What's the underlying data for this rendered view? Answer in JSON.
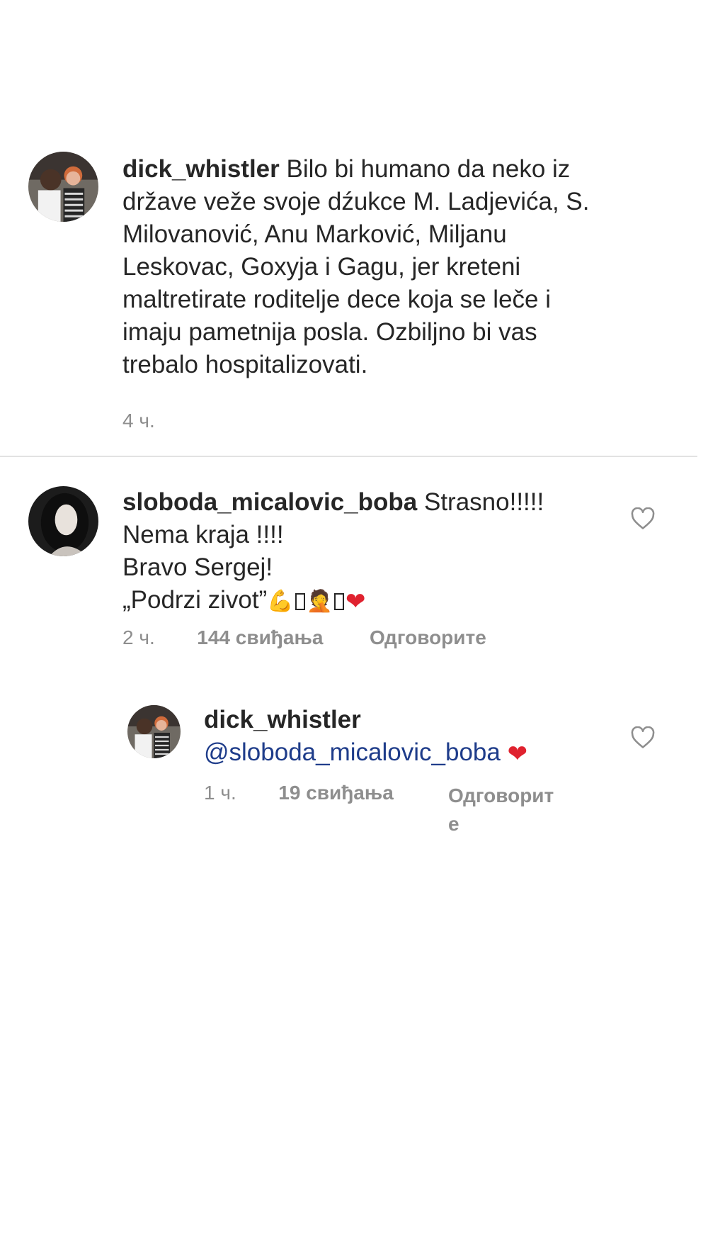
{
  "comments": [
    {
      "username": "dick_whistler",
      "text": "Bilo bi humano da neko iz\ndržave veže svoje dźukce M. Ladjevića, S.\nMilovanović, Anu Marković, Miljanu\nLeskovac, Goxyja i Gagu, jer kreteni\nmaltretirate roditelje dece koja se leče i\nimaju pametnija posla. Ozbiljno bi vas\ntrebalo hospitalizovati.",
      "time": "4 ч."
    },
    {
      "username": "sloboda_micalovic_boba",
      "text_first": "Strasno!!!!!",
      "text_rest": "Nema kraja !!!!\nBravo Sergej!\n„Podrzi zivot”",
      "time": "2 ч.",
      "likes": "144 свиђања",
      "reply_label": "Одговорите"
    },
    {
      "username": "dick_whistler",
      "mention": "@sloboda_micalovic_boba",
      "time": "1 ч.",
      "likes": "19 свиђања",
      "reply_label_line1": "Одговорит",
      "reply_label_line2": "е"
    }
  ],
  "icons": {
    "like": "heart-outline-icon",
    "heart_emoji": "❤",
    "muscle_emoji": "💪",
    "facepalm_emoji": "🤦"
  },
  "colors": {
    "text": "#262626",
    "meta": "#8e8e8e",
    "mention": "#1e3c8a",
    "heart": "#e0222f"
  }
}
